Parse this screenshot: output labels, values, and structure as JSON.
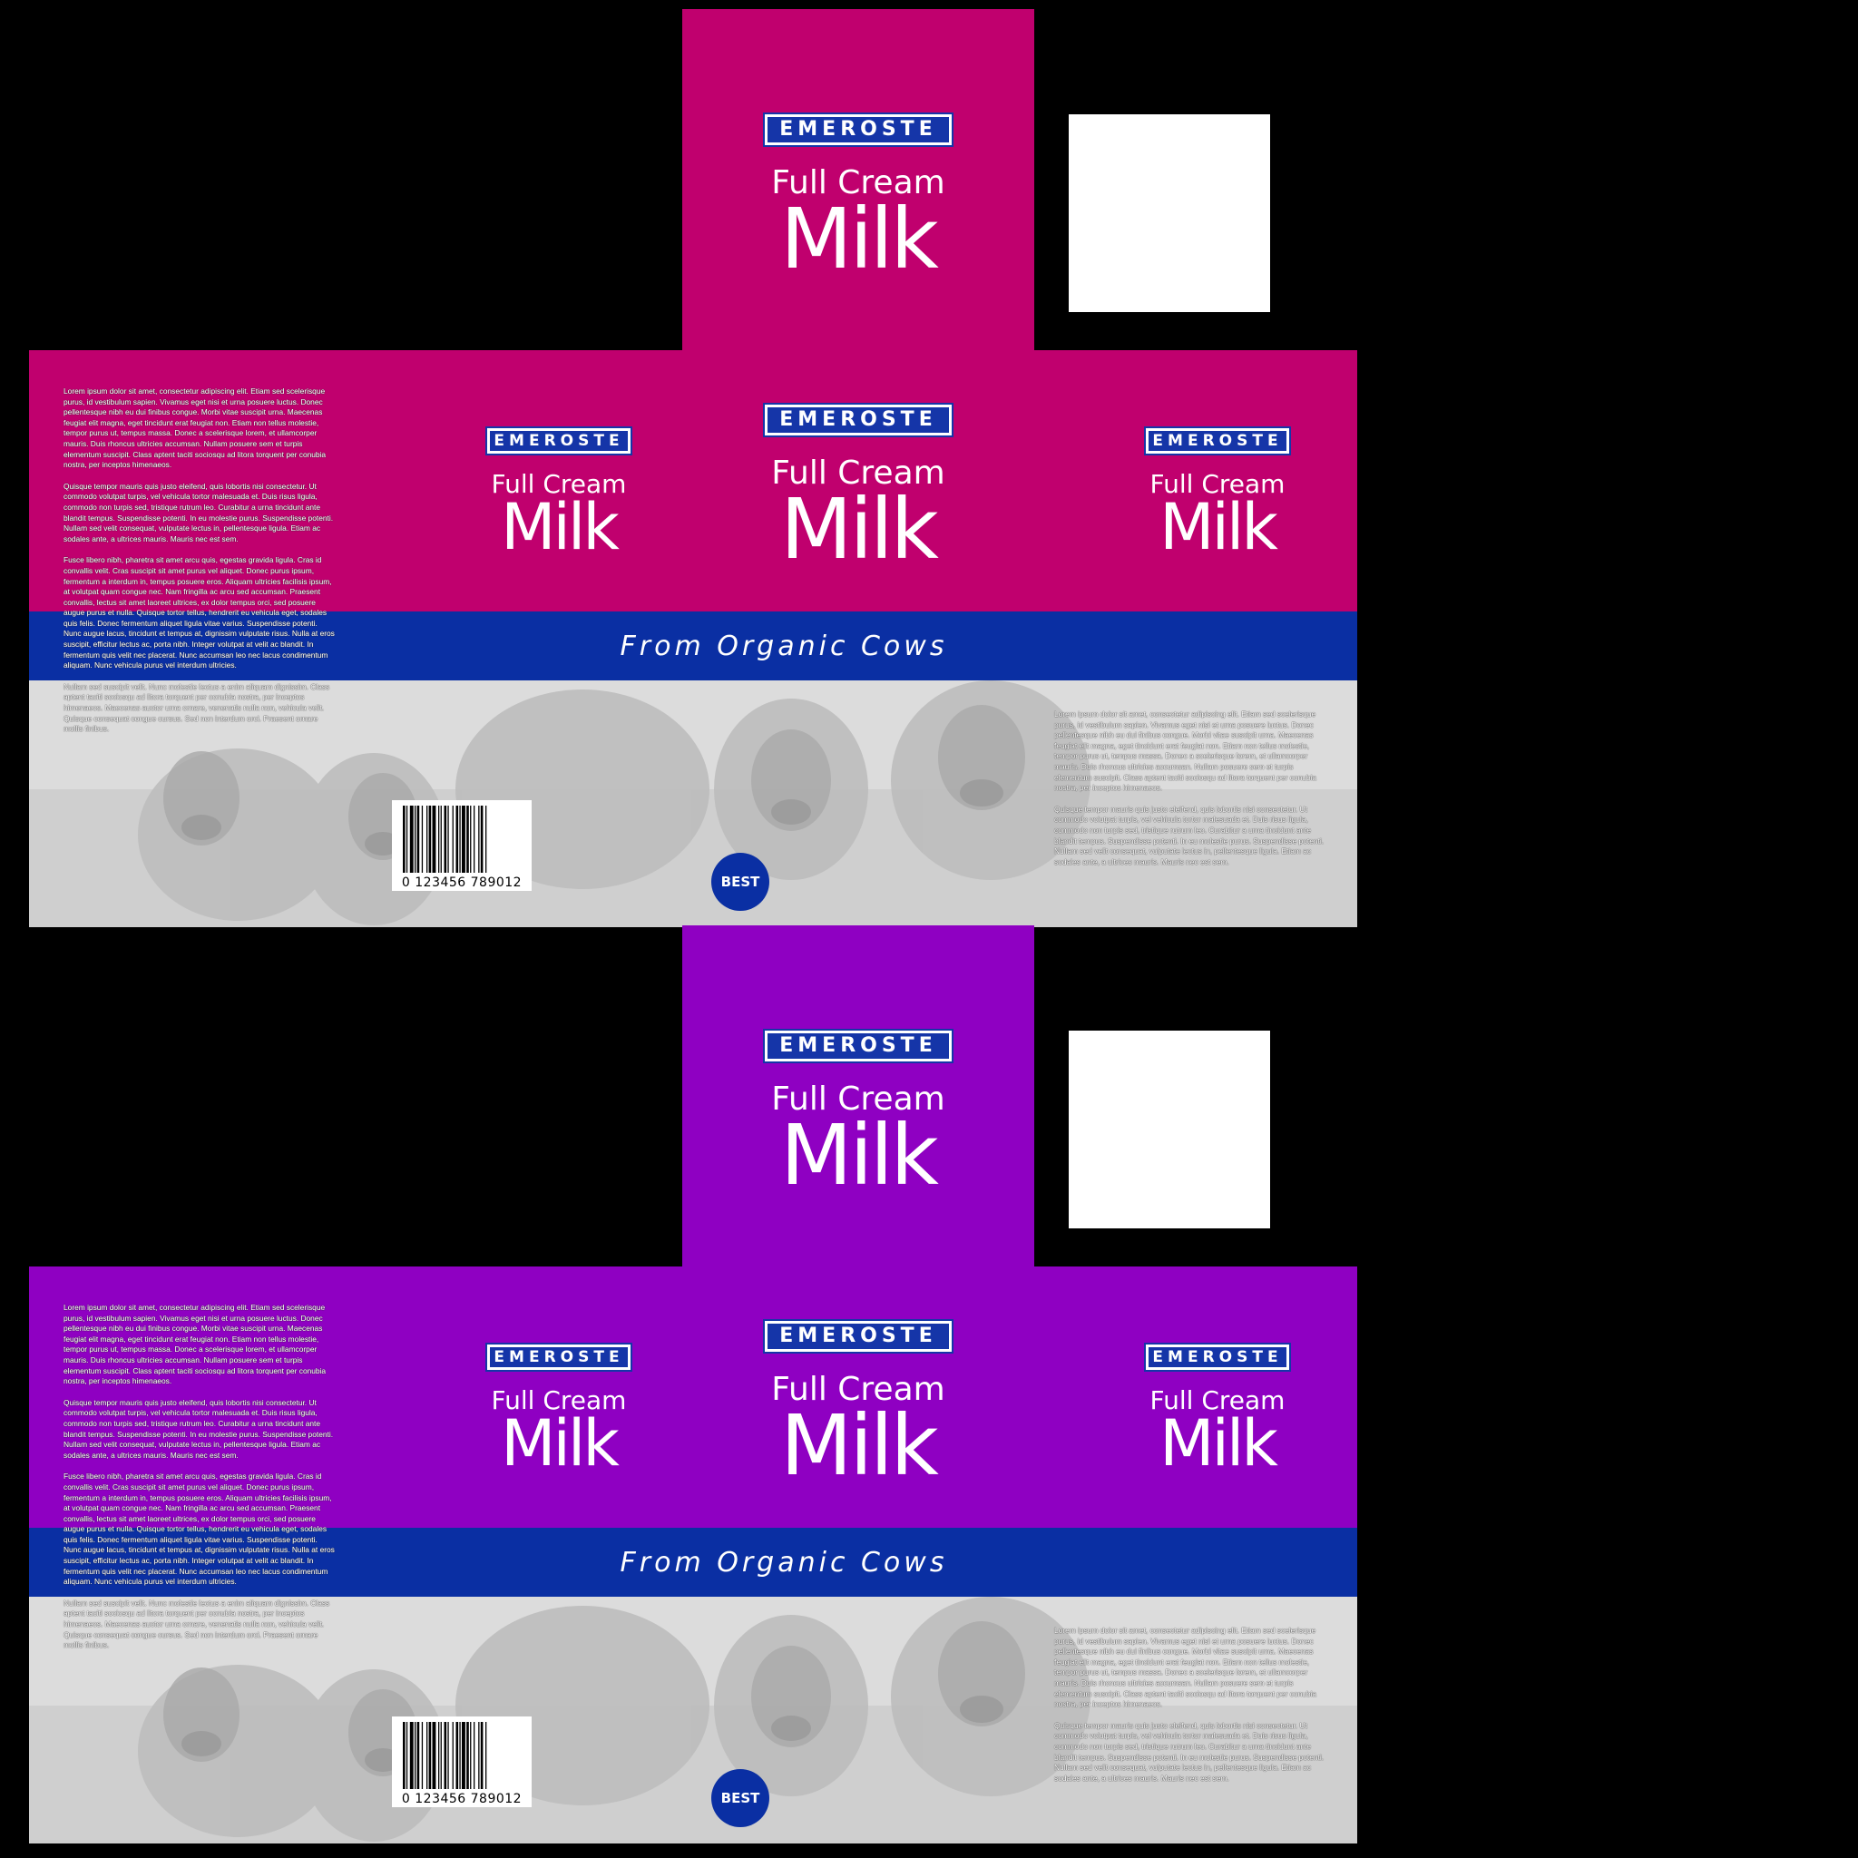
{
  "colors": {
    "background": "#000000",
    "version_1": "#c0006e",
    "version_2": "#8f00c2",
    "band_blue": "#0a2fa3",
    "logo_blue": "#1535a8",
    "photo_grey": "#d9d9d9"
  },
  "brand": "EMEROSTE",
  "product_line_1": "Full Cream",
  "product_line_2": "Milk",
  "tagline": "From Organic Cows",
  "badge": "BEST",
  "barcode_number": "0 123456 789012",
  "side_panel_paragraphs": [
    "Lorem ipsum dolor sit amet, consectetur adipiscing elit. Etiam sed scelerisque purus, id vestibulum sapien. Vivamus eget nisi et urna posuere luctus. Donec pellentesque nibh eu dui finibus congue. Morbi vitae suscipit urna. Maecenas feugiat elit magna, eget tincidunt erat feugiat non. Etiam non tellus molestie, tempor purus ut, tempus massa. Donec a scelerisque lorem, et ullamcorper mauris. Duis rhoncus ultricies accumsan. Nullam posuere sem et turpis elementum suscipit. Class aptent taciti sociosqu ad litora torquent per conubia nostra, per inceptos himenaeos.",
    "Quisque tempor mauris quis justo eleifend, quis lobortis nisi consectetur. Ut commodo volutpat turpis, vel vehicula tortor malesuada et. Duis risus ligula, commodo non turpis sed, tristique rutrum leo. Curabitur a urna tincidunt ante blandit tempus. Suspendisse potenti. In eu molestie purus. Suspendisse potenti. Nullam sed velit consequat, vulputate lectus in, pellentesque ligula. Etiam ac sodales ante, a ultrices mauris. Mauris nec est sem.",
    "Fusce libero nibh, pharetra sit amet arcu quis, egestas gravida ligula. Cras id convallis velit. Cras suscipit sit amet purus vel aliquet. Donec purus ipsum, fermentum a interdum in, tempus posuere eros. Aliquam ultricies facilisis ipsum, at volutpat quam congue nec. Nam fringilla ac arcu sed accumsan. Praesent convallis, lectus sit amet laoreet ultrices, ex dolor tempus orci, sed posuere augue purus et nulla. Quisque tortor tellus, hendrerit eu vehicula eget, sodales quis felis. Donec fermentum aliquet ligula vitae varius. Suspendisse potenti. Nunc augue lacus, tincidunt et tempus at, dignissim vulputate risus. Nulla at eros suscipit, efficitur lectus ac, porta nibh. Integer volutpat at velit ac blandit. In fermentum quis velit nec placerat. Nunc accumsan leo nec lacus condimentum aliquam. Nunc vehicula purus vel interdum ultricies.",
    "Nullam sed suscipit velit. Nunc molestie lectus a enim aliquam dignissim. Class aptent taciti sociosqu ad litora torquent per conubia nostra, per inceptos himenaeos. Maecenas auctor urna ornare, venenatis nulla non, vehicula velit. Quisque consequat congue cursus. Sed non interdum orci. Praesent ornare mollis finibus."
  ],
  "right_panel_paragraphs": [
    "Lorem ipsum dolor sit amet, consectetur adipiscing elit. Etiam sed scelerisque purus, id vestibulum sapien. Vivamus eget nisi et urna posuere luctus. Donec pellentesque nibh eu dui finibus congue. Morbi vitae suscipit urna. Maecenas feugiat elit magna, eget tincidunt erat feugiat non. Etiam non tellus molestie, tempor purus ut, tempus massa. Donec a scelerisque lorem, et ullamcorper mauris. Duis rhoncus ultricies accumsan. Nullam posuere sem et turpis elementum suscipit. Class aptent taciti sociosqu ad litora torquent per conubia nostra, per inceptos himenaeos.",
    "Quisque tempor mauris quis justo eleifend, quis lobortis nisi consectetur. Ut commodo volutpat turpis, vel vehicula tortor malesuada et. Duis risus ligula, commodo non turpis sed, tristique rutrum leo. Curabitur a urna tincidunt ante blandit tempus. Suspendisse potenti. In eu molestie purus. Suspendisse potenti. Nullam sed velit consequat, vulputate lectus in, pellentesque ligula. Etiam ac sodales ante, a ultrices mauris. Mauris nec est sem."
  ]
}
